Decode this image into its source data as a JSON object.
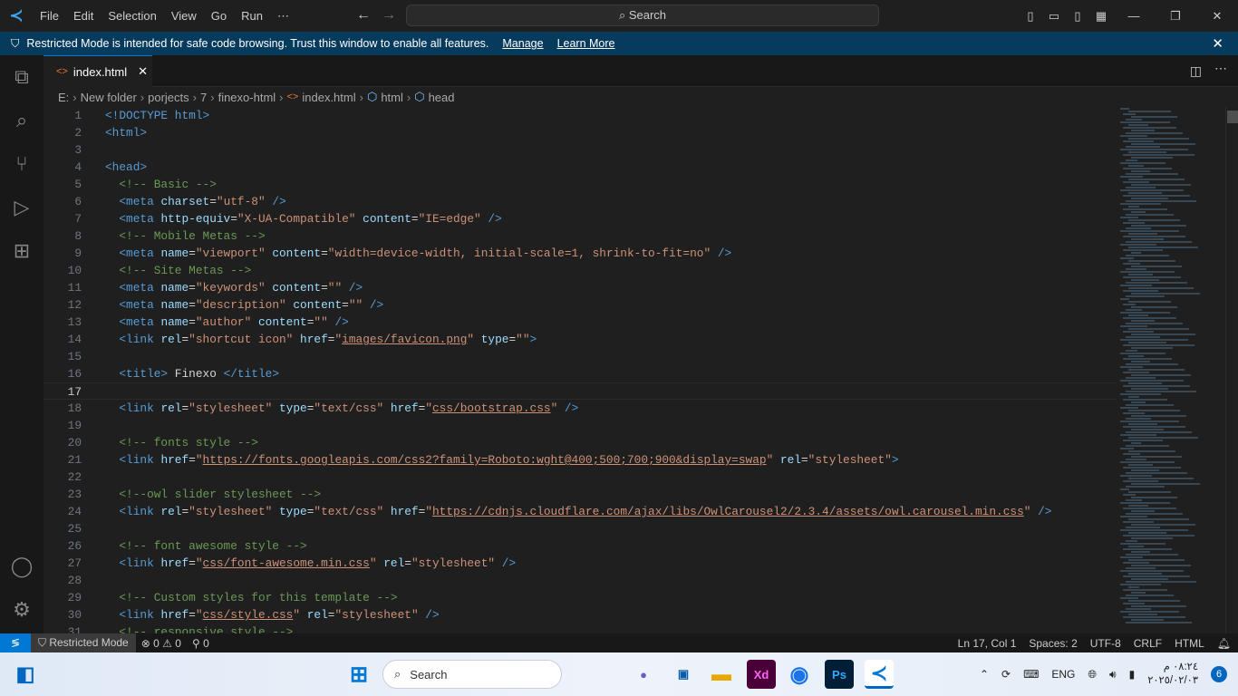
{
  "titlebar": {
    "menu": [
      "File",
      "Edit",
      "Selection",
      "View",
      "Go",
      "Run",
      "⋯"
    ],
    "search": "Search"
  },
  "banner": {
    "text": "Restricted Mode is intended for safe code browsing. Trust this window to enable all features.",
    "manage": "Manage",
    "learn_more": "Learn More"
  },
  "tab": {
    "label": "index.html"
  },
  "breadcrumb": [
    "E:",
    "New folder",
    "porjects",
    "7",
    "finexo-html",
    "index.html",
    "html",
    "head"
  ],
  "editor": {
    "current_line": 17,
    "lines": [
      [
        [
          "tag",
          "<!DOCTYPE html>"
        ]
      ],
      [
        [
          "tag",
          "<html>"
        ]
      ],
      [],
      [
        [
          "tag",
          "<head>"
        ]
      ],
      [
        [
          "txt",
          "  "
        ],
        [
          "com",
          "<!-- Basic -->"
        ]
      ],
      [
        [
          "txt",
          "  "
        ],
        [
          "tag",
          "<meta "
        ],
        [
          "attr",
          "charset"
        ],
        [
          "txt",
          "="
        ],
        [
          "str",
          "\"utf-8\""
        ],
        [
          "tag",
          " />"
        ]
      ],
      [
        [
          "txt",
          "  "
        ],
        [
          "tag",
          "<meta "
        ],
        [
          "attr",
          "http-equiv"
        ],
        [
          "txt",
          "="
        ],
        [
          "str",
          "\"X-UA-Compatible\""
        ],
        [
          "attr",
          " content"
        ],
        [
          "txt",
          "="
        ],
        [
          "str",
          "\"IE=edge\""
        ],
        [
          "tag",
          " />"
        ]
      ],
      [
        [
          "txt",
          "  "
        ],
        [
          "com",
          "<!-- Mobile Metas -->"
        ]
      ],
      [
        [
          "txt",
          "  "
        ],
        [
          "tag",
          "<meta "
        ],
        [
          "attr",
          "name"
        ],
        [
          "txt",
          "="
        ],
        [
          "str",
          "\"viewport\""
        ],
        [
          "attr",
          " content"
        ],
        [
          "txt",
          "="
        ],
        [
          "str",
          "\"width=device-width, initial-scale=1, shrink-to-fit=no\""
        ],
        [
          "tag",
          " />"
        ]
      ],
      [
        [
          "txt",
          "  "
        ],
        [
          "com",
          "<!-- Site Metas -->"
        ]
      ],
      [
        [
          "txt",
          "  "
        ],
        [
          "tag",
          "<meta "
        ],
        [
          "attr",
          "name"
        ],
        [
          "txt",
          "="
        ],
        [
          "str",
          "\"keywords\""
        ],
        [
          "attr",
          " content"
        ],
        [
          "txt",
          "="
        ],
        [
          "str",
          "\"\""
        ],
        [
          "tag",
          " />"
        ]
      ],
      [
        [
          "txt",
          "  "
        ],
        [
          "tag",
          "<meta "
        ],
        [
          "attr",
          "name"
        ],
        [
          "txt",
          "="
        ],
        [
          "str",
          "\"description\""
        ],
        [
          "attr",
          " content"
        ],
        [
          "txt",
          "="
        ],
        [
          "str",
          "\"\""
        ],
        [
          "tag",
          " />"
        ]
      ],
      [
        [
          "txt",
          "  "
        ],
        [
          "tag",
          "<meta "
        ],
        [
          "attr",
          "name"
        ],
        [
          "txt",
          "="
        ],
        [
          "str",
          "\"author\""
        ],
        [
          "attr",
          " content"
        ],
        [
          "txt",
          "="
        ],
        [
          "str",
          "\"\""
        ],
        [
          "tag",
          " />"
        ]
      ],
      [
        [
          "txt",
          "  "
        ],
        [
          "tag",
          "<link "
        ],
        [
          "attr",
          "rel"
        ],
        [
          "txt",
          "="
        ],
        [
          "str",
          "\"shortcut icon\""
        ],
        [
          "attr",
          " href"
        ],
        [
          "txt",
          "="
        ],
        [
          "str",
          "\""
        ],
        [
          "url",
          "images/favicon.png"
        ],
        [
          "str",
          "\""
        ],
        [
          "attr",
          " type"
        ],
        [
          "txt",
          "="
        ],
        [
          "str",
          "\"\""
        ],
        [
          "tag",
          ">"
        ]
      ],
      [],
      [
        [
          "txt",
          "  "
        ],
        [
          "tag",
          "<title>"
        ],
        [
          "txt",
          " Finexo "
        ],
        [
          "tag",
          "</title>"
        ]
      ],
      [],
      [
        [
          "txt",
          "  "
        ],
        [
          "tag",
          "<link "
        ],
        [
          "attr",
          "rel"
        ],
        [
          "txt",
          "="
        ],
        [
          "str",
          "\"stylesheet\""
        ],
        [
          "attr",
          " type"
        ],
        [
          "txt",
          "="
        ],
        [
          "str",
          "\"text/css\""
        ],
        [
          "attr",
          " href"
        ],
        [
          "txt",
          "="
        ],
        [
          "str",
          "\""
        ],
        [
          "url",
          "css/bootstrap.css"
        ],
        [
          "str",
          "\""
        ],
        [
          "tag",
          " />"
        ]
      ],
      [],
      [
        [
          "txt",
          "  "
        ],
        [
          "com",
          "<!-- fonts style -->"
        ]
      ],
      [
        [
          "txt",
          "  "
        ],
        [
          "tag",
          "<link "
        ],
        [
          "attr",
          "href"
        ],
        [
          "txt",
          "="
        ],
        [
          "str",
          "\""
        ],
        [
          "url",
          "https://fonts.googleapis.com/css2?family=Roboto:wght@400;500;700;900&display=swap"
        ],
        [
          "str",
          "\""
        ],
        [
          "attr",
          " rel"
        ],
        [
          "txt",
          "="
        ],
        [
          "str",
          "\"stylesheet\""
        ],
        [
          "tag",
          ">"
        ]
      ],
      [],
      [
        [
          "txt",
          "  "
        ],
        [
          "com",
          "<!--owl slider stylesheet -->"
        ]
      ],
      [
        [
          "txt",
          "  "
        ],
        [
          "tag",
          "<link "
        ],
        [
          "attr",
          "rel"
        ],
        [
          "txt",
          "="
        ],
        [
          "str",
          "\"stylesheet\""
        ],
        [
          "attr",
          " type"
        ],
        [
          "txt",
          "="
        ],
        [
          "str",
          "\"text/css\""
        ],
        [
          "attr",
          " href"
        ],
        [
          "txt",
          "="
        ],
        [
          "str",
          "\""
        ],
        [
          "url",
          "https://cdnjs.cloudflare.com/ajax/libs/OwlCarousel2/2.3.4/assets/owl.carousel.min.css"
        ],
        [
          "str",
          "\""
        ],
        [
          "tag",
          " />"
        ]
      ],
      [],
      [
        [
          "txt",
          "  "
        ],
        [
          "com",
          "<!-- font awesome style -->"
        ]
      ],
      [
        [
          "txt",
          "  "
        ],
        [
          "tag",
          "<link "
        ],
        [
          "attr",
          "href"
        ],
        [
          "txt",
          "="
        ],
        [
          "str",
          "\""
        ],
        [
          "url",
          "css/font-awesome.min.css"
        ],
        [
          "str",
          "\""
        ],
        [
          "attr",
          " rel"
        ],
        [
          "txt",
          "="
        ],
        [
          "str",
          "\"stylesheet\""
        ],
        [
          "tag",
          " />"
        ]
      ],
      [],
      [
        [
          "txt",
          "  "
        ],
        [
          "com",
          "<!-- Custom styles for this template -->"
        ]
      ],
      [
        [
          "txt",
          "  "
        ],
        [
          "tag",
          "<link "
        ],
        [
          "attr",
          "href"
        ],
        [
          "txt",
          "="
        ],
        [
          "str",
          "\""
        ],
        [
          "url",
          "css/style.css"
        ],
        [
          "str",
          "\""
        ],
        [
          "attr",
          " rel"
        ],
        [
          "txt",
          "="
        ],
        [
          "str",
          "\"stylesheet\""
        ],
        [
          "tag",
          " />"
        ]
      ],
      [
        [
          "txt",
          "  "
        ],
        [
          "com",
          "<!-- responsive style -->"
        ]
      ]
    ]
  },
  "status": {
    "mode": "Restricted Mode",
    "errors": "0",
    "warnings": "0",
    "ports": "0",
    "position": "Ln 17, Col 1",
    "spaces": "Spaces: 2",
    "encoding": "UTF-8",
    "eol": "CRLF",
    "language": "HTML"
  },
  "taskbar": {
    "search": "Search",
    "lang": "ENG",
    "time": "٠٨:٢٤ م",
    "date": "٢٠٢٥/٠٢/٠٣",
    "notifications": "6"
  },
  "colors": {
    "accent": "#0078d4",
    "banner": "#063b5e",
    "tag": "#569cd6",
    "attr": "#9cdcfe",
    "string": "#ce9178",
    "comment": "#6a9955"
  }
}
